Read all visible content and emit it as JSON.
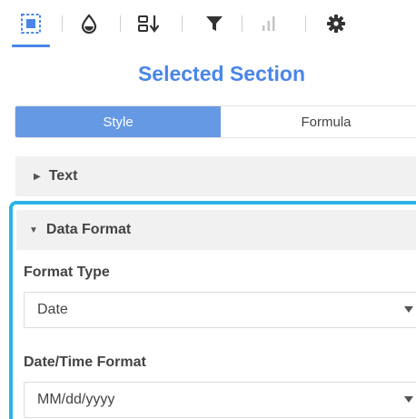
{
  "toolbar": {
    "icons": [
      {
        "name": "selection-icon",
        "active": true
      },
      {
        "name": "color-drop-icon"
      },
      {
        "name": "sort-icon"
      },
      {
        "name": "filter-icon"
      },
      {
        "name": "chart-icon",
        "disabled": true
      },
      {
        "name": "gear-icon"
      }
    ],
    "active_color": "#4a86e8"
  },
  "panel": {
    "title": "Selected Section",
    "tabs": [
      {
        "label": "Style",
        "active": true
      },
      {
        "label": "Formula",
        "active": false
      }
    ]
  },
  "sections": {
    "text": {
      "label": "Text",
      "expanded": false
    },
    "data_format": {
      "label": "Data Format",
      "expanded": true,
      "format_type": {
        "label": "Format Type",
        "value": "Date"
      },
      "datetime_format": {
        "label": "Date/Time Format",
        "value": "MM/dd/yyyy"
      }
    }
  },
  "colors": {
    "accent": "#4a86e8",
    "tab_active_bg": "#6699e3",
    "focus_ring": "#2bb2e6",
    "section_header_bg": "#f1f1f1"
  }
}
